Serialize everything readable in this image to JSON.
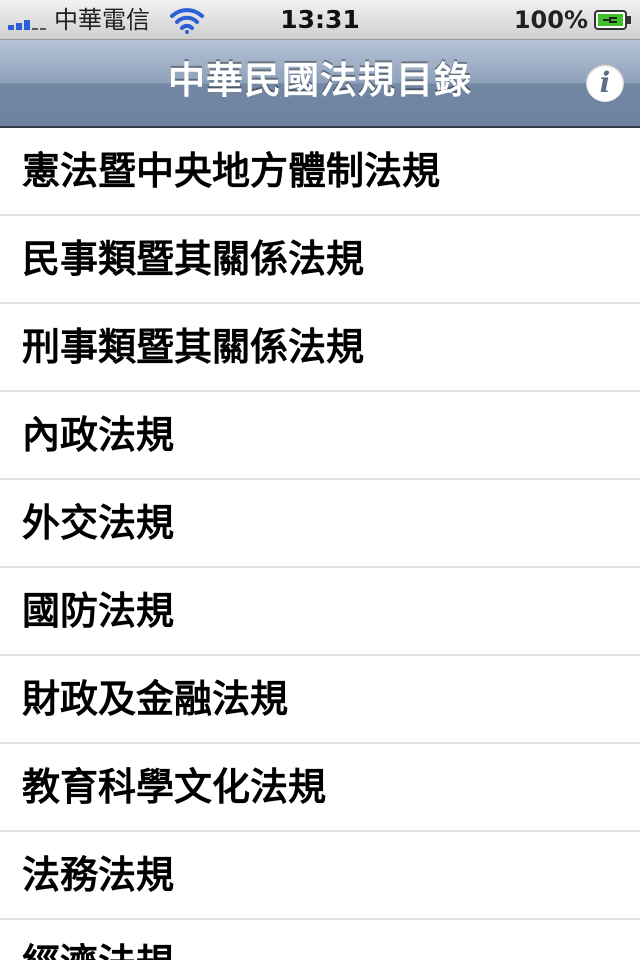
{
  "status_bar": {
    "carrier": "中華電信",
    "time": "13:31",
    "battery": "100%"
  },
  "nav_bar": {
    "title": "中華民國法規目錄",
    "info_icon": "info-icon",
    "info_glyph": "i"
  },
  "categories": [
    {
      "label": "憲法暨中央地方體制法規"
    },
    {
      "label": "民事類暨其關係法規"
    },
    {
      "label": "刑事類暨其關係法規"
    },
    {
      "label": "內政法規"
    },
    {
      "label": "外交法規"
    },
    {
      "label": "國防法規"
    },
    {
      "label": "財政及金融法規"
    },
    {
      "label": "教育科學文化法規"
    },
    {
      "label": "法務法規"
    },
    {
      "label": "經濟法規"
    }
  ],
  "colors": {
    "nav_bar": "#8ea1bb",
    "signal_active": "#2c5fd6",
    "battery_fill": "#3fbf2a"
  }
}
